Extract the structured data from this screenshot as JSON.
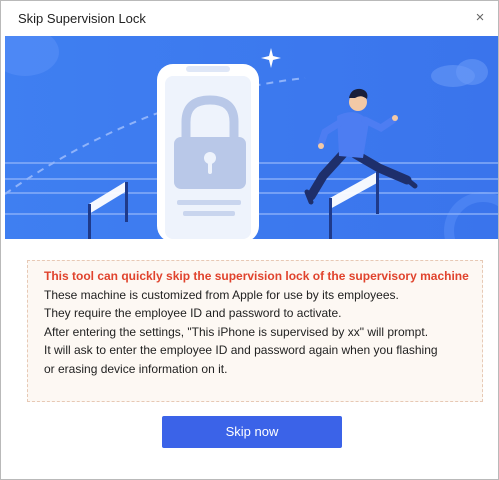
{
  "window": {
    "title": "Skip Supervision Lock",
    "close_glyph": "×"
  },
  "banner": {
    "icons": [
      "lock-icon",
      "sparkle-icon",
      "cloud-icon"
    ],
    "colors": {
      "background": "#3a78ef",
      "accent": "#5a8ff7",
      "phone": "#ffffff",
      "lock": "#b9c8e8"
    }
  },
  "info": {
    "headline": "This tool can quickly skip the supervision lock of the supervisory machine",
    "lines": [
      "These machine is customized from Apple for use by its employees.",
      "They require the employee ID and password to activate.",
      "After entering the settings, \"This iPhone is supervised by xx\" will prompt.",
      "It will ask to enter the employee ID and password again when you flashing",
      "or erasing device information on it."
    ],
    "colors": {
      "headline": "#e0432d",
      "background": "#fdf8f3",
      "border": "#e7c9b5"
    }
  },
  "actions": {
    "skip_label": "Skip now",
    "colors": {
      "button": "#3b63e8",
      "text": "#ffffff"
    }
  }
}
